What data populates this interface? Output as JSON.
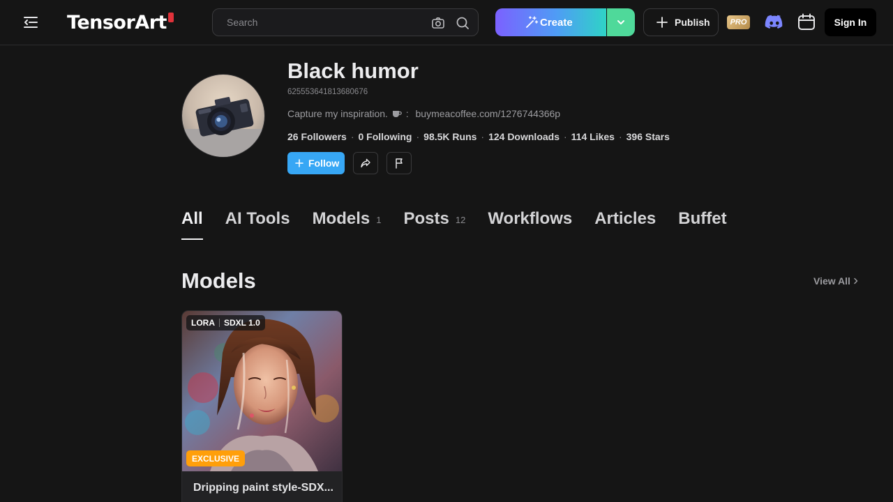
{
  "header": {
    "logo_text": "TensorArt",
    "search_placeholder": "Search",
    "create_label": "Create",
    "publish_label": "Publish",
    "pro_label": "PRO",
    "signin_label": "Sign In"
  },
  "profile": {
    "name": "Black humor",
    "id": "625553641813680676",
    "bio_prefix": "Capture my inspiration.",
    "bio_separator": ":",
    "bio_link": "buymeacoffee.com/1276744366p",
    "stats": [
      "26 Followers",
      "0 Following",
      "98.5K Runs",
      "124 Downloads",
      "114 Likes",
      "396 Stars"
    ],
    "follow_label": "Follow"
  },
  "tabs": [
    {
      "label": "All",
      "count": ""
    },
    {
      "label": "AI Tools",
      "count": ""
    },
    {
      "label": "Models",
      "count": "1"
    },
    {
      "label": "Posts",
      "count": "12"
    },
    {
      "label": "Workflows",
      "count": ""
    },
    {
      "label": "Articles",
      "count": ""
    },
    {
      "label": "Buffet",
      "count": ""
    }
  ],
  "section": {
    "title": "Models",
    "view_all_label": "View All"
  },
  "cards": [
    {
      "type": "LORA",
      "base_model": "SDXL 1.0",
      "badge": "EXCLUSIVE",
      "title": "Dripping paint style-SDX..."
    }
  ],
  "colors": {
    "background": "#151515",
    "follow_blue": "#37a7f5",
    "exclusive_orange": "#ff9f0a",
    "create_gradient_start": "#7b61ff",
    "create_gradient_end": "#2fd3c6"
  }
}
